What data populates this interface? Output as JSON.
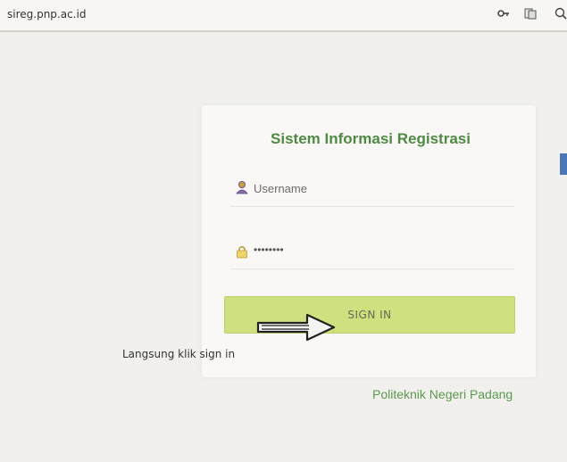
{
  "browser": {
    "url": "sireg.pnp.ac.id",
    "icons": [
      "key-icon",
      "page-icon",
      "zoom-icon"
    ]
  },
  "login": {
    "title": "Sistem Informasi Registrasi",
    "username_placeholder": "Username",
    "password_value": "••••••••",
    "signin_label": "SIGN IN"
  },
  "annotation": {
    "text": "Langsung klik sign in"
  },
  "footer": {
    "text": "Politeknik Negeri Padang"
  },
  "colors": {
    "title": "#4e8a43",
    "button": "#cfe17e",
    "footer": "#5a9a4d",
    "side_tab": "#4a78b6"
  }
}
